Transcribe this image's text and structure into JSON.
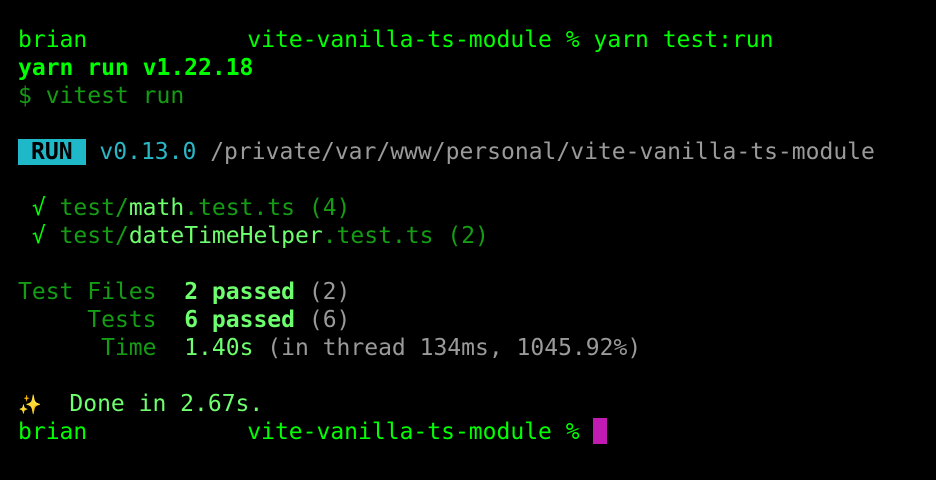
{
  "prompt1": {
    "user": "brian",
    "dir": "vite-vanilla-ts-module",
    "symbol": "%",
    "command": "yarn test:run"
  },
  "yarn_version_line": "yarn run v1.22.18",
  "run_command": "$ vitest run",
  "run_header": {
    "badge": "RUN",
    "version": "v0.13.0",
    "path": "/private/var/www/personal/vite-vanilla-ts-module"
  },
  "tests": [
    {
      "check": "√",
      "dir": "test/",
      "name": "math",
      "ext": ".test.ts",
      "count": "(4)"
    },
    {
      "check": "√",
      "dir": "test/",
      "name": "dateTimeHelper",
      "ext": ".test.ts",
      "count": "(2)"
    }
  ],
  "summary": {
    "files_label": "Test Files",
    "files_passed": "2 passed",
    "files_total": "(2)",
    "tests_label": "Tests",
    "tests_passed": "6 passed",
    "tests_total": "(6)",
    "time_label": "Time",
    "time_value": "1.40s",
    "time_detail": "(in thread 134ms, 1045.92%)"
  },
  "done": {
    "icon": "sparkles-icon",
    "text": "Done in 2.67s."
  },
  "prompt2": {
    "user": "brian",
    "dir": "vite-vanilla-ts-module",
    "symbol": "%"
  },
  "colors": {
    "background": "#000000",
    "prompt_green": "#00ff00",
    "dim_green": "#159c15",
    "bright_green": "#6dff6d",
    "badge_bg": "#1fb8c9",
    "cursor": "#c21bb4"
  }
}
